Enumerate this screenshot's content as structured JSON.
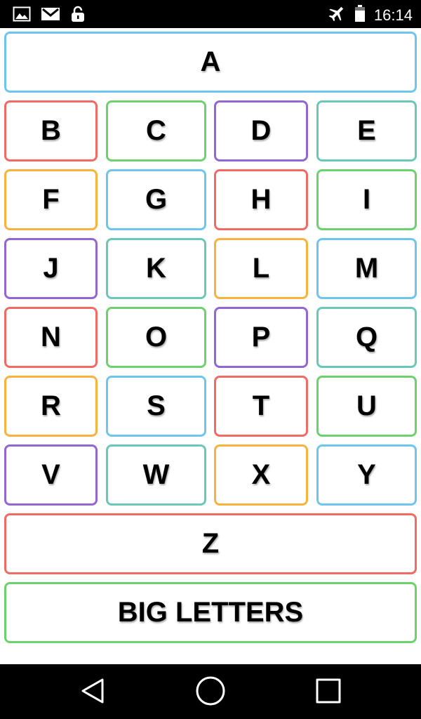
{
  "status_bar": {
    "time": "16:14",
    "icons": [
      "image-icon",
      "gmail-icon",
      "lock-icon",
      "airplane-mode-icon",
      "battery-icon"
    ]
  },
  "colors": {
    "red": "#F16A64",
    "green": "#6DD16D",
    "purple": "#9466D3",
    "teal": "#6CC7B8",
    "orange": "#F8B23F",
    "blue": "#6EC6EF"
  },
  "keys": {
    "A": "A",
    "B": "B",
    "C": "C",
    "D": "D",
    "E": "E",
    "F": "F",
    "G": "G",
    "H": "H",
    "I": "I",
    "J": "J",
    "K": "K",
    "L": "L",
    "M": "M",
    "N": "N",
    "O": "O",
    "P": "P",
    "Q": "Q",
    "R": "R",
    "S": "S",
    "T": "T",
    "U": "U",
    "V": "V",
    "W": "W",
    "X": "X",
    "Y": "Y",
    "Z": "Z"
  },
  "big_letters_label": "BIG LETTERS",
  "navigation": [
    "back-icon",
    "home-icon",
    "recents-icon"
  ]
}
